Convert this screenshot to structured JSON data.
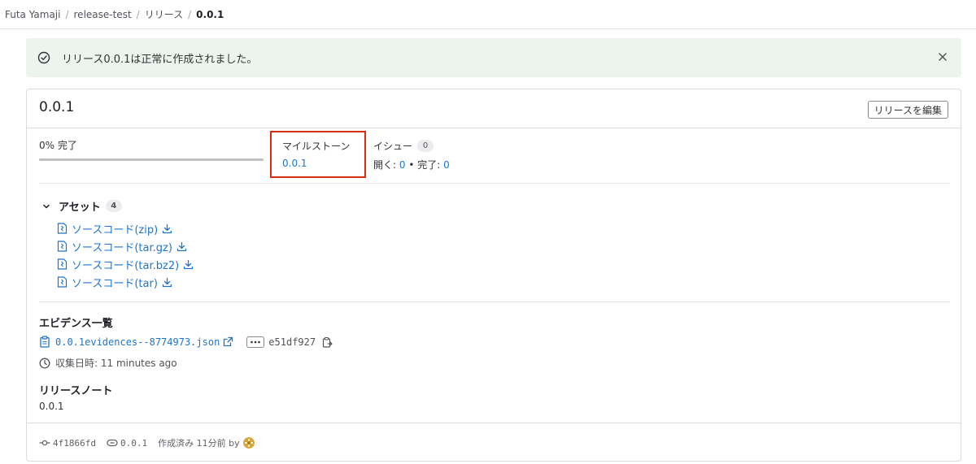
{
  "breadcrumb": {
    "items": [
      "Futa Yamaji",
      "release-test",
      "リリース",
      "0.0.1"
    ],
    "separator": "/"
  },
  "alert": {
    "message": "リリース0.0.1は正常に作成されました。",
    "icon": "check-circle-icon",
    "close_icon": "close-icon"
  },
  "release": {
    "title": "0.0.1",
    "edit_label": "リリースを編集"
  },
  "progress": {
    "label": "0% 完了",
    "percent": 0
  },
  "milestone": {
    "label": "マイルストーン",
    "link": "0.0.1"
  },
  "issues": {
    "label": "イシュー",
    "count": "0",
    "open_label": "開く:",
    "open_count": "0",
    "bullet": "•",
    "closed_label": "完了:",
    "closed_count": "0"
  },
  "assets": {
    "label": "アセット",
    "count": "4",
    "items": [
      {
        "label": "ソースコード(zip)"
      },
      {
        "label": "ソースコード(tar.gz)"
      },
      {
        "label": "ソースコード(tar.bz2)"
      },
      {
        "label": "ソースコード(tar)"
      }
    ]
  },
  "evidence": {
    "title": "エビデンス一覧",
    "file": "0.0.1evidences--8774973.json",
    "sha": "e51df927",
    "collected": "収集日時: 11 minutes ago"
  },
  "notes": {
    "title": "リリースノート",
    "text": "0.0.1"
  },
  "footer": {
    "commit": "4f1866fd",
    "tag": "0.0.1",
    "created": "作成済み 11分前 by"
  },
  "colors": {
    "link": "#1f75cb",
    "alert_bg": "#ecf4ee",
    "success": "#108548",
    "highlight": "#dd2b0e"
  }
}
